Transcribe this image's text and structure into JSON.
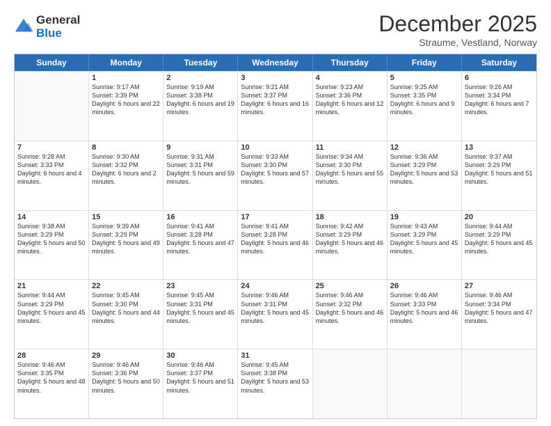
{
  "header": {
    "logo_general": "General",
    "logo_blue": "Blue",
    "title": "December 2025",
    "subtitle": "Straume, Vestland, Norway"
  },
  "days": [
    "Sunday",
    "Monday",
    "Tuesday",
    "Wednesday",
    "Thursday",
    "Friday",
    "Saturday"
  ],
  "weeks": [
    [
      {
        "day": "",
        "sunrise": "",
        "sunset": "",
        "daylight": ""
      },
      {
        "day": "1",
        "sunrise": "Sunrise: 9:17 AM",
        "sunset": "Sunset: 3:39 PM",
        "daylight": "Daylight: 6 hours and 22 minutes."
      },
      {
        "day": "2",
        "sunrise": "Sunrise: 9:19 AM",
        "sunset": "Sunset: 3:38 PM",
        "daylight": "Daylight: 6 hours and 19 minutes."
      },
      {
        "day": "3",
        "sunrise": "Sunrise: 9:21 AM",
        "sunset": "Sunset: 3:37 PM",
        "daylight": "Daylight: 6 hours and 16 minutes."
      },
      {
        "day": "4",
        "sunrise": "Sunrise: 9:23 AM",
        "sunset": "Sunset: 3:36 PM",
        "daylight": "Daylight: 6 hours and 12 minutes."
      },
      {
        "day": "5",
        "sunrise": "Sunrise: 9:25 AM",
        "sunset": "Sunset: 3:35 PM",
        "daylight": "Daylight: 6 hours and 9 minutes."
      },
      {
        "day": "6",
        "sunrise": "Sunrise: 9:26 AM",
        "sunset": "Sunset: 3:34 PM",
        "daylight": "Daylight: 6 hours and 7 minutes."
      }
    ],
    [
      {
        "day": "7",
        "sunrise": "Sunrise: 9:28 AM",
        "sunset": "Sunset: 3:33 PM",
        "daylight": "Daylight: 6 hours and 4 minutes."
      },
      {
        "day": "8",
        "sunrise": "Sunrise: 9:30 AM",
        "sunset": "Sunset: 3:32 PM",
        "daylight": "Daylight: 6 hours and 2 minutes."
      },
      {
        "day": "9",
        "sunrise": "Sunrise: 9:31 AM",
        "sunset": "Sunset: 3:31 PM",
        "daylight": "Daylight: 5 hours and 59 minutes."
      },
      {
        "day": "10",
        "sunrise": "Sunrise: 9:33 AM",
        "sunset": "Sunset: 3:30 PM",
        "daylight": "Daylight: 5 hours and 57 minutes."
      },
      {
        "day": "11",
        "sunrise": "Sunrise: 9:34 AM",
        "sunset": "Sunset: 3:30 PM",
        "daylight": "Daylight: 5 hours and 55 minutes."
      },
      {
        "day": "12",
        "sunrise": "Sunrise: 9:36 AM",
        "sunset": "Sunset: 3:29 PM",
        "daylight": "Daylight: 5 hours and 53 minutes."
      },
      {
        "day": "13",
        "sunrise": "Sunrise: 9:37 AM",
        "sunset": "Sunset: 3:29 PM",
        "daylight": "Daylight: 5 hours and 51 minutes."
      }
    ],
    [
      {
        "day": "14",
        "sunrise": "Sunrise: 9:38 AM",
        "sunset": "Sunset: 3:29 PM",
        "daylight": "Daylight: 5 hours and 50 minutes."
      },
      {
        "day": "15",
        "sunrise": "Sunrise: 9:39 AM",
        "sunset": "Sunset: 3:29 PM",
        "daylight": "Daylight: 5 hours and 49 minutes."
      },
      {
        "day": "16",
        "sunrise": "Sunrise: 9:41 AM",
        "sunset": "Sunset: 3:28 PM",
        "daylight": "Daylight: 5 hours and 47 minutes."
      },
      {
        "day": "17",
        "sunrise": "Sunrise: 9:41 AM",
        "sunset": "Sunset: 3:28 PM",
        "daylight": "Daylight: 5 hours and 46 minutes."
      },
      {
        "day": "18",
        "sunrise": "Sunrise: 9:42 AM",
        "sunset": "Sunset: 3:29 PM",
        "daylight": "Daylight: 5 hours and 46 minutes."
      },
      {
        "day": "19",
        "sunrise": "Sunrise: 9:43 AM",
        "sunset": "Sunset: 3:29 PM",
        "daylight": "Daylight: 5 hours and 45 minutes."
      },
      {
        "day": "20",
        "sunrise": "Sunrise: 9:44 AM",
        "sunset": "Sunset: 3:29 PM",
        "daylight": "Daylight: 5 hours and 45 minutes."
      }
    ],
    [
      {
        "day": "21",
        "sunrise": "Sunrise: 9:44 AM",
        "sunset": "Sunset: 3:29 PM",
        "daylight": "Daylight: 5 hours and 45 minutes."
      },
      {
        "day": "22",
        "sunrise": "Sunrise: 9:45 AM",
        "sunset": "Sunset: 3:30 PM",
        "daylight": "Daylight: 5 hours and 44 minutes."
      },
      {
        "day": "23",
        "sunrise": "Sunrise: 9:45 AM",
        "sunset": "Sunset: 3:31 PM",
        "daylight": "Daylight: 5 hours and 45 minutes."
      },
      {
        "day": "24",
        "sunrise": "Sunrise: 9:46 AM",
        "sunset": "Sunset: 3:31 PM",
        "daylight": "Daylight: 5 hours and 45 minutes."
      },
      {
        "day": "25",
        "sunrise": "Sunrise: 9:46 AM",
        "sunset": "Sunset: 3:32 PM",
        "daylight": "Daylight: 5 hours and 46 minutes."
      },
      {
        "day": "26",
        "sunrise": "Sunrise: 9:46 AM",
        "sunset": "Sunset: 3:33 PM",
        "daylight": "Daylight: 5 hours and 46 minutes."
      },
      {
        "day": "27",
        "sunrise": "Sunrise: 9:46 AM",
        "sunset": "Sunset: 3:34 PM",
        "daylight": "Daylight: 5 hours and 47 minutes."
      }
    ],
    [
      {
        "day": "28",
        "sunrise": "Sunrise: 9:46 AM",
        "sunset": "Sunset: 3:35 PM",
        "daylight": "Daylight: 5 hours and 48 minutes."
      },
      {
        "day": "29",
        "sunrise": "Sunrise: 9:46 AM",
        "sunset": "Sunset: 3:36 PM",
        "daylight": "Daylight: 5 hours and 50 minutes."
      },
      {
        "day": "30",
        "sunrise": "Sunrise: 9:46 AM",
        "sunset": "Sunset: 3:37 PM",
        "daylight": "Daylight: 5 hours and 51 minutes."
      },
      {
        "day": "31",
        "sunrise": "Sunrise: 9:45 AM",
        "sunset": "Sunset: 3:38 PM",
        "daylight": "Daylight: 5 hours and 53 minutes."
      },
      {
        "day": "",
        "sunrise": "",
        "sunset": "",
        "daylight": ""
      },
      {
        "day": "",
        "sunrise": "",
        "sunset": "",
        "daylight": ""
      },
      {
        "day": "",
        "sunrise": "",
        "sunset": "",
        "daylight": ""
      }
    ]
  ]
}
